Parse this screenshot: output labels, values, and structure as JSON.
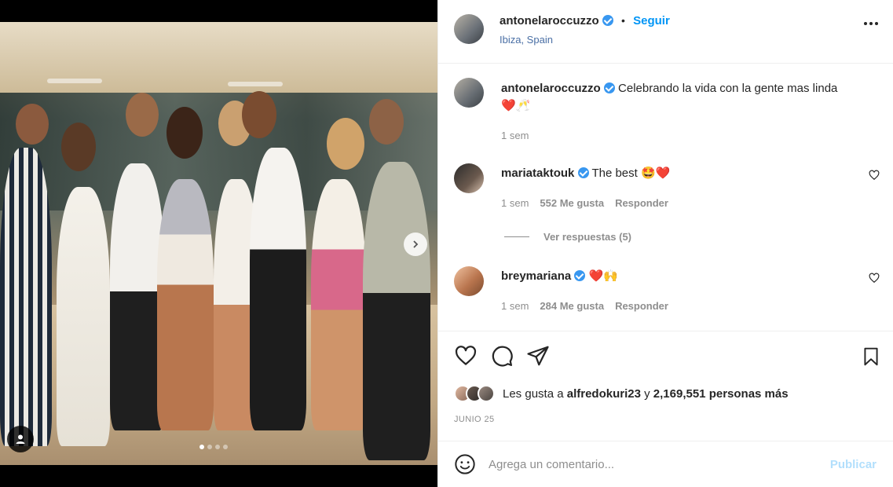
{
  "post": {
    "author": "antonelaroccuzzo",
    "follow_label": "Seguir",
    "separator": "•",
    "location": "Ibiza, Spain",
    "caption_username": "antonelaroccuzzo",
    "caption_text": "Celebrando la vida con la gente mas linda",
    "caption_emojis": "❤️🥂",
    "caption_time": "1 sem"
  },
  "comments": [
    {
      "username": "mariataktouk",
      "text": "The best",
      "emojis": "🤩❤️",
      "time": "1 sem",
      "likes": "552 Me gusta",
      "reply_label": "Responder"
    },
    {
      "username": "breymariana",
      "text": "",
      "emojis": "❤️🙌",
      "time": "1 sem",
      "likes": "284 Me gusta",
      "reply_label": "Responder"
    }
  ],
  "view_replies": "Ver respuestas (5)",
  "likes_line": {
    "prefix": "Les gusta a",
    "user": "alfredokuri23",
    "connector": "y",
    "count": "2,169,551 personas más"
  },
  "date": "JUNIO 25",
  "add_comment": {
    "placeholder": "Agrega un comentario...",
    "publish_label": "Publicar"
  },
  "carousel": {
    "slides": 4,
    "active": 0
  },
  "icons": {
    "more": "more-options-icon",
    "heart": "heart-icon",
    "comment": "comment-icon",
    "share": "share-icon",
    "save": "bookmark-icon",
    "emoji": "emoji-icon",
    "next": "chevron-right-icon",
    "tag": "user-tag-icon"
  },
  "colors": {
    "accent": "#0095f6",
    "verified": "#3897f0",
    "muted": "#8e8e8e",
    "publish_disabled": "#b2dffc"
  }
}
